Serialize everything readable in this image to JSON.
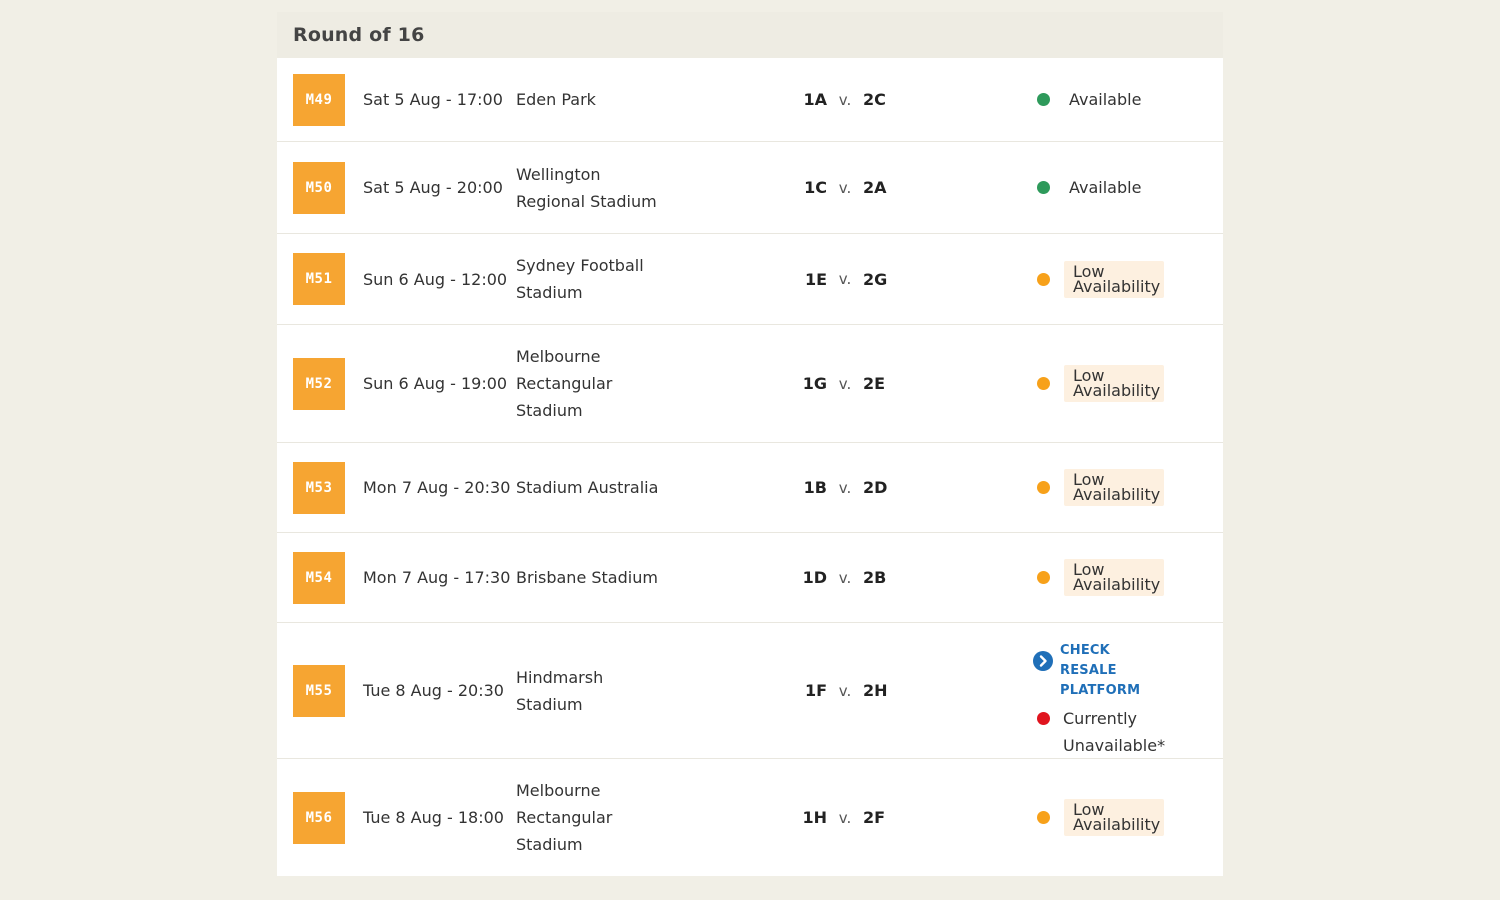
{
  "section": {
    "title": "Round of 16"
  },
  "colors": {
    "available": "#2e9a5b",
    "low": "#f7a11a",
    "unavailable": "#e0141e",
    "badge": "#f6a532",
    "link": "#1f6fb8"
  },
  "matches": [
    {
      "code": "M49",
      "datetime": "Sat 5 Aug - 17:00",
      "venue": "Eden Park",
      "team_a": "1A",
      "versus": "v.",
      "team_b": "2C",
      "status": "Available"
    },
    {
      "code": "M50",
      "datetime": "Sat 5 Aug - 20:00",
      "venue": "Wellington Regional Stadium",
      "team_a": "1C",
      "versus": "v.",
      "team_b": "2A",
      "status": "Available"
    },
    {
      "code": "M51",
      "datetime": "Sun 6 Aug - 12:00",
      "venue": "Sydney Football Stadium",
      "team_a": "1E",
      "versus": "v.",
      "team_b": "2G",
      "status": "Low Availability"
    },
    {
      "code": "M52",
      "datetime": "Sun 6 Aug - 19:00",
      "venue": "Melbourne Rectangular Stadium",
      "team_a": "1G",
      "versus": "v.",
      "team_b": "2E",
      "status": "Low Availability"
    },
    {
      "code": "M53",
      "datetime": "Mon 7 Aug - 20:30",
      "venue": "Stadium Australia",
      "team_a": "1B",
      "versus": "v.",
      "team_b": "2D",
      "status": "Low Availability"
    },
    {
      "code": "M54",
      "datetime": "Mon 7 Aug - 17:30",
      "venue": "Brisbane Stadium",
      "team_a": "1D",
      "versus": "v.",
      "team_b": "2B",
      "status": "Low Availability"
    },
    {
      "code": "M55",
      "datetime": "Tue 8 Aug - 20:30",
      "venue": "Hindmarsh Stadium",
      "team_a": "1F",
      "versus": "v.",
      "team_b": "2H",
      "status": "Currently Unavailable*",
      "resale_link": "CHECK RESALE PLATFORM"
    },
    {
      "code": "M56",
      "datetime": "Tue 8 Aug - 18:00",
      "venue": "Melbourne Rectangular Stadium",
      "team_a": "1H",
      "versus": "v.",
      "team_b": "2F",
      "status": "Low Availability"
    }
  ]
}
